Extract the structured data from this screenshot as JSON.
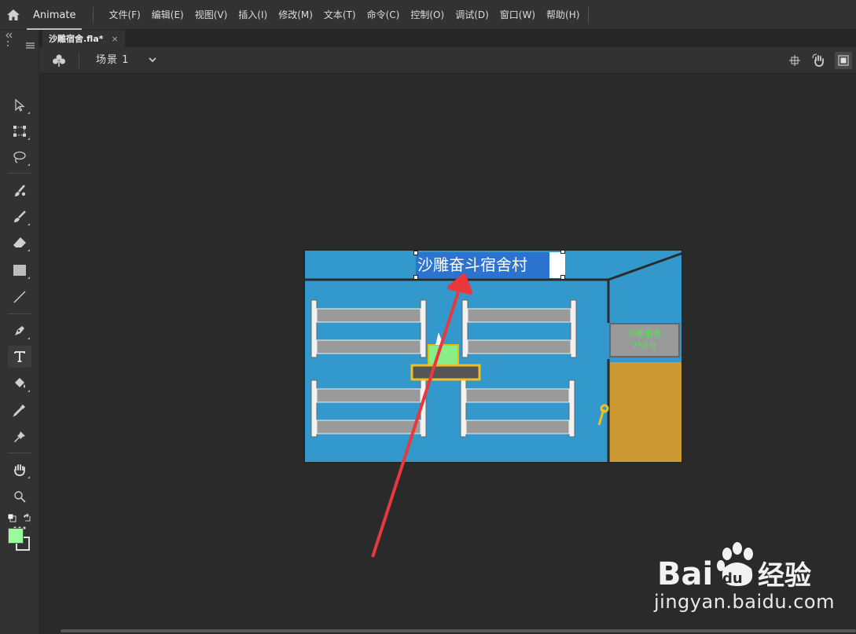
{
  "app": {
    "name": "Animate"
  },
  "menu": {
    "items": [
      "文件(F)",
      "编辑(E)",
      "视图(V)",
      "插入(I)",
      "修改(M)",
      "文本(T)",
      "命令(C)",
      "控制(O)",
      "调试(D)",
      "窗口(W)",
      "帮助(H)"
    ]
  },
  "document_tab": {
    "title": "沙雕宿舍.fla*",
    "close": "×"
  },
  "scene": {
    "label": "场景 1"
  },
  "toolbar": {
    "tools": [
      "selection-tool",
      "free-transform-tool",
      "lasso-tool",
      "paint-brush-tool",
      "brush-tool",
      "eraser-tool",
      "rectangle-tool",
      "line-tool",
      "pen-tool",
      "text-tool",
      "paint-bucket-tool",
      "eyedropper-tool",
      "pin-tool",
      "hand-tool",
      "zoom-tool",
      "more-tools"
    ],
    "active": "text-tool",
    "fill_color": "#99ff99"
  },
  "stage": {
    "title_text": "沙雕奋斗宿舍村",
    "door_sign": {
      "line1": "沙雕宿舍",
      "line2": "250号"
    },
    "colors": {
      "wall": "#3399cc",
      "door": "#cc9933",
      "sign_text": "#55e055",
      "selection": "#2b73cf"
    }
  },
  "annotation": {
    "arrow_color": "#e8383d"
  },
  "watermark": {
    "brand": "Bai",
    "brand2": "du",
    "brand3": "经验",
    "url": "jingyan.baidu.com"
  }
}
